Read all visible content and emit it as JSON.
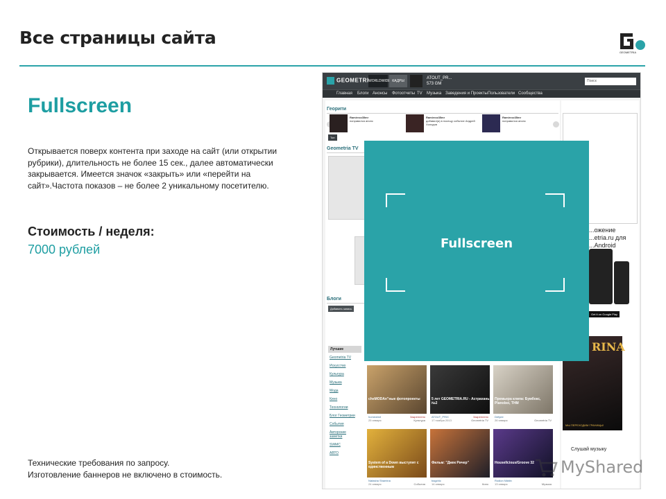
{
  "slide": {
    "title": "Все страницы сайта",
    "section_heading": "Fullscreen",
    "description": "Открывается поверх контента при заходе на сайт (или открытии рубрики), длительность не более 15 сек., далее автоматически закрывается. Имеется значок «закрыть» или «перейти на сайт».Частота показов – не более 2 уникальному посетителю.",
    "cost_label": "Стоимость / неделя:",
    "cost_value": "7000 рублей",
    "footnote_line1": "Технические требования по запросу.",
    "footnote_line2": "Изготовление баннеров не включено в стоимость.",
    "accent_color": "#2aa3a8"
  },
  "logo": {
    "label": "GEOMETRIA",
    "icon": "geometria-logo-icon"
  },
  "overlay": {
    "label": "Fullscreen",
    "color": "#2aa3a8"
  },
  "site": {
    "logo": "GEOMETRIA",
    "header_boxes": [
      "WORLDWIDE",
      "КАДРЫ"
    ],
    "header_text": "ATOUT_PR...",
    "header_sub": "573 GM",
    "search_placeholder": "Поиск",
    "nav": [
      "Главная",
      "Блоги",
      "Анонсы",
      "Фотоотчеты",
      "TV",
      "Музыка",
      "Заведения и Проекты",
      "Пользователи",
      "Сообщества"
    ],
    "block_georiti": "Георити",
    "block_geometria_tv": "Geometria TV",
    "block_blogs": "Блоги",
    "add_blog_button": "Добавить запись",
    "top_button": "Топ",
    "georiti_items": [
      {
        "user": "Ramirezz35mr",
        "text": "понравился анонс"
      },
      {
        "user": "Ramirezz35mr",
        "text": "добавил(а) в посещу событие Андрей Холодов"
      },
      {
        "user": "Ramirezz35mr",
        "text": "понравился анонс"
      }
    ],
    "blog_menu_active": "Лучшие",
    "blog_menu": [
      "Geometria TV",
      "Искусство",
      "Культура",
      "Музыка",
      "Мода",
      "Кино",
      "Технологии",
      "Блог Геометрии",
      "События",
      "Авторские заметки",
      "SWMC",
      "АВТО"
    ],
    "cards": [
      {
        "caption": "cheMODAn\"ные фотопроекты",
        "user": "homeofart",
        "date": "25 января",
        "tag": "Закреплено",
        "cat": "Культура"
      },
      {
        "caption": "5 лет GEOMETRIA.RU - Астрахань №2",
        "user": "ATOUT_PRIX",
        "date": "17 ноября 2013",
        "tag": "Закреплено",
        "cat": "Geometria TV"
      },
      {
        "caption": "Премьера клипа: Бумбокс, Planoboi, THM",
        "user": "Defyee",
        "date": "26 января",
        "tag": "",
        "cat": "Geometria TV"
      },
      {
        "caption": "System of a Down выступят с единственным",
        "user": "Natasha Shamina",
        "date": "24 января",
        "tag": "",
        "cat": "События"
      },
      {
        "caption": "Фильм: \"Джек Ричер\"",
        "user": "bagchic",
        "date": "14 января",
        "tag": "",
        "cat": "Кино"
      },
      {
        "caption": "Housellcious/Groove 32",
        "user": "Rodion Nikitin",
        "date": "13 января",
        "tag": "",
        "cat": "Музыка"
      }
    ],
    "right_promo": "...ожение ...etria.ru для ...Android",
    "google_play": "Get it on Google Play",
    "banner_text": "RINA",
    "banner_caption": "МЫ ПЕРЕХОДИМ ГРАНИЦЫ!",
    "listen_music": "Слушай музыку"
  },
  "watermark": {
    "text": "MyShared"
  }
}
